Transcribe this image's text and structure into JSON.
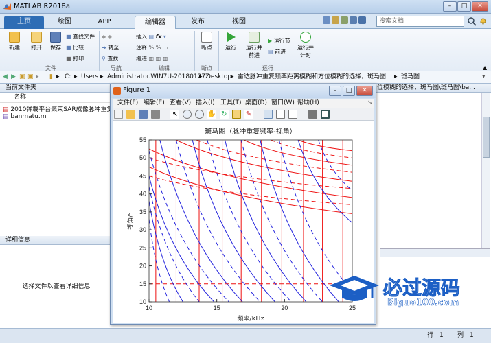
{
  "window": {
    "title": "MATLAB R2018a"
  },
  "tabs": [
    {
      "label": "主页",
      "active": false
    },
    {
      "label": "绘图",
      "active": false
    },
    {
      "label": "APP",
      "active": false
    },
    {
      "label": "编辑器",
      "active": true
    },
    {
      "label": "发布",
      "active": false
    },
    {
      "label": "视图",
      "active": false
    }
  ],
  "search": {
    "placeholder": "搜索文档"
  },
  "ribbon": {
    "file": {
      "new": "新建",
      "open": "打开",
      "save": "保存",
      "find_files": "查找文件",
      "compare": "比较",
      "print": "打印",
      "group": "文件"
    },
    "nav": {
      "goto": "转至",
      "find": "查找",
      "group": "导航"
    },
    "edit": {
      "insert": "插入",
      "comment": "注释",
      "indent": "缩进",
      "fx": "fx",
      "group": "编辑"
    },
    "breakpoints": {
      "label": "断点",
      "group": "断点"
    },
    "run": {
      "run": "运行",
      "run_advance_1": "运行并",
      "run_advance_2": "前进",
      "run_section": "运行节",
      "advance": "前进",
      "run_time_1": "运行并",
      "run_time_2": "计时",
      "group": "运行"
    }
  },
  "address": {
    "path": [
      "C:",
      "Users",
      "Administrator.WIN7U-20180127Z",
      "Desktop",
      "雷达脉冲重复频率距离模糊和方位模糊的选择，斑马图",
      "斑马图"
    ]
  },
  "current_folder": {
    "header": "当前文件夹",
    "column": "名称",
    "files": [
      {
        "name": "2010弹載平台聚束SAR成像脉冲重复...",
        "icon": "pdf-icon"
      },
      {
        "name": "banmatu.m",
        "icon": "m-file-icon"
      }
    ]
  },
  "details": {
    "header": "详细信息",
    "hint": "选择文件以查看详细信息"
  },
  "right_header": "位模糊的选择，斑马图\\斑马图\\ba...",
  "status": {
    "row_label": "行",
    "row": "1",
    "col_label": "列",
    "col": "1"
  },
  "figure": {
    "title": "Figure 1",
    "menu": [
      "文件(F)",
      "编辑(E)",
      "查看(V)",
      "插入(I)",
      "工具(T)",
      "桌面(D)",
      "窗口(W)",
      "帮助(H)"
    ]
  },
  "chart_data": {
    "type": "line",
    "title": "斑马图（脉冲重复频率-视角）",
    "xlabel": "频率/kHz",
    "ylabel": "视角/°",
    "xlim": [
      10,
      25
    ],
    "ylim": [
      10,
      55
    ],
    "xticks": [
      10,
      15,
      20,
      25
    ],
    "yticks": [
      10,
      15,
      20,
      25,
      30,
      35,
      40,
      45,
      50,
      55
    ],
    "grid": false,
    "series": [
      {
        "color": "#ee1111",
        "style": "solid",
        "kind": "vertical",
        "values": [
          10.5,
          12.0,
          13.7,
          15.4,
          16.8,
          18.3,
          19.8,
          21.4,
          22.8,
          24.3
        ]
      },
      {
        "color": "#ee1111",
        "style": "dashed",
        "kind": "horizontal",
        "values": [
          15
        ]
      },
      {
        "color": "#ee1111",
        "style": "solid",
        "kind": "curve",
        "values": [
          [
            10,
            47.5,
            25,
            34.5
          ],
          [
            10,
            52.5,
            25,
            39
          ],
          [
            12,
            55,
            25,
            43.5
          ],
          [
            17,
            55,
            25,
            48
          ],
          [
            21,
            55,
            25,
            52
          ]
        ]
      },
      {
        "color": "#ee1111",
        "style": "dashed",
        "kind": "curve",
        "values": [
          [
            10,
            45,
            25,
            37
          ],
          [
            10,
            50,
            25,
            41.5
          ],
          [
            13.5,
            55,
            25,
            46
          ],
          [
            19,
            55,
            25,
            50
          ]
        ]
      },
      {
        "color": "#2222dd",
        "style": "solid",
        "kind": "curve",
        "values": [
          [
            10,
            38,
            12.5,
            10
          ],
          [
            10,
            45,
            14.8,
            10
          ],
          [
            10.8,
            55,
            16.9,
            10
          ],
          [
            13.2,
            55,
            19.3,
            10
          ],
          [
            15.6,
            55,
            21.6,
            10
          ],
          [
            18.2,
            55,
            24,
            10
          ],
          [
            21,
            55,
            25,
            32
          ]
        ]
      },
      {
        "color": "#2222dd",
        "style": "dashed",
        "kind": "curve",
        "values": [
          [
            10,
            33,
            11.5,
            10
          ],
          [
            10,
            42,
            13.7,
            10
          ],
          [
            10,
            52,
            15.9,
            10
          ],
          [
            12,
            55,
            18.2,
            10
          ],
          [
            14.3,
            55,
            20.5,
            10
          ],
          [
            16.8,
            55,
            22.8,
            10
          ],
          [
            19.6,
            55,
            25,
            13
          ],
          [
            22.5,
            55,
            25,
            41
          ]
        ]
      }
    ]
  },
  "watermark": {
    "title": "必过源码",
    "url": "Biguo100.com"
  }
}
